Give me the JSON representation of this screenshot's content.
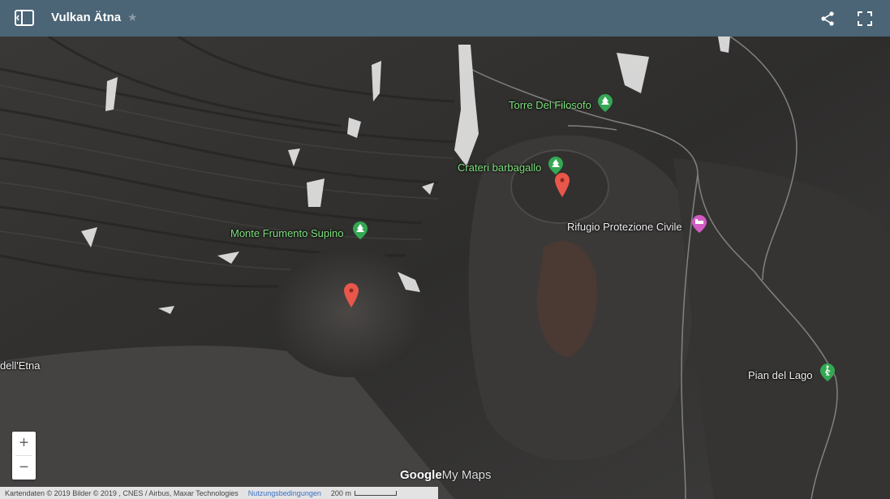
{
  "header": {
    "title": "Vulkan Ätna"
  },
  "pois": [
    {
      "label": "Torre Del Filosofo",
      "icon": "tree-icon",
      "color": "green"
    },
    {
      "label": "Crateri barbagallo",
      "icon": "tree-icon",
      "color": "green"
    },
    {
      "label": "Monte Frumento Supino",
      "icon": "tree-icon",
      "color": "green"
    },
    {
      "label": "Rifugio Protezione Civile",
      "icon": "lodging-icon",
      "color": "pink"
    },
    {
      "label": "Pian del Lago",
      "icon": "hiker-icon",
      "color": "green"
    },
    {
      "label": "dell'Etna",
      "icon": "",
      "color": "green"
    }
  ],
  "zoom": {
    "in": "+",
    "out": "−"
  },
  "logo": {
    "google": "Google",
    "mymaps": "My Maps"
  },
  "footer": {
    "attribution": "Kartendaten © 2019 Bilder © 2019 , CNES / Airbus, Maxar Technologies",
    "terms": "Nutzungsbedingungen",
    "scale": "200 m"
  },
  "colors": {
    "header": "#4b6476",
    "green_label": "#7ee07e",
    "marker": "#e8574a"
  }
}
